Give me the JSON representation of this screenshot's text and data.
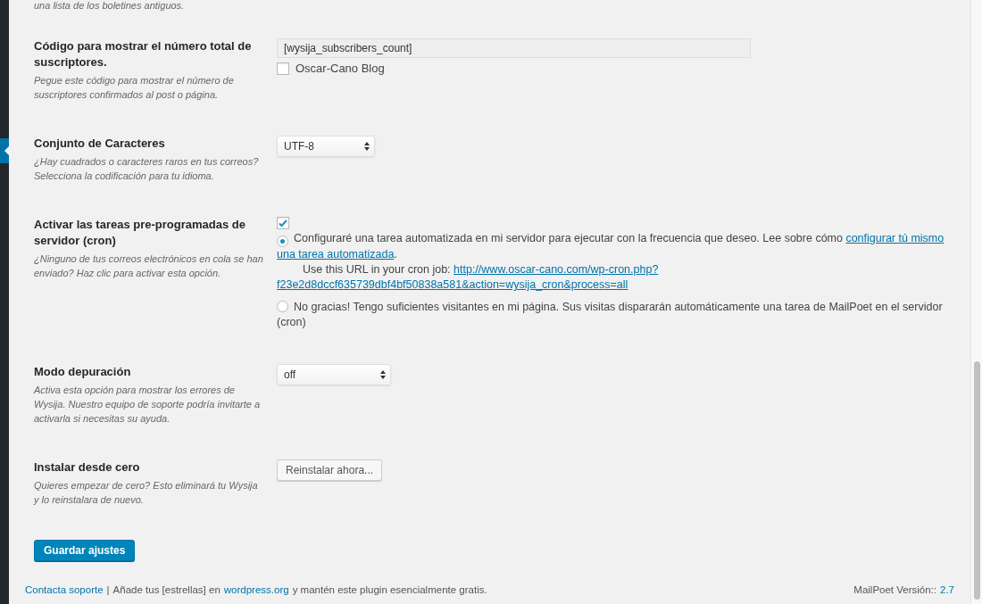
{
  "top_note": "una lista de los boletines antiguos.",
  "settings": [
    {
      "kind": "shortcode",
      "label": "Código para mostrar el número total de suscriptores.",
      "description": "Pegue este código para mostrar el número de suscriptores confirmados al post o página.",
      "value": "[wysija_subscribers_count]",
      "checkbox": {
        "label": "Oscar-Cano Blog",
        "checked": false
      }
    },
    {
      "kind": "select",
      "label": "Conjunto de Caracteres",
      "description": "¿Hay cuadrados o caracteres raros en tus correos? Selecciona la codificación para tu idioma.",
      "value": "UTF-8"
    },
    {
      "kind": "cron",
      "label": "Activar las tareas pre-programadas de servidor (cron)",
      "description": "¿Ninguno de tus correos electrónicos en cola se han enviado? Haz clic para activar esta opción.",
      "checked": true,
      "options": [
        {
          "selected": true,
          "text": "Configuraré una tarea automatizada en mi servidor para ejecutar con la frecuencia que deseo. Lee sobre cómo ",
          "link": [
            "configurar tú mismo",
            "una tarea automatizada"
          ],
          "after": ".",
          "url_label": "Use this URL in your cron job: ",
          "url": [
            "http://www.oscar-cano.com/wp-cron.php?",
            "f23e2d8dccf635739dbf4bf50838a581&action=wysija_cron&process=all"
          ]
        },
        {
          "selected": false,
          "text": "No gracias! Tengo suficientes visitantes en mi página. Sus visitas dispararán automáticamente una tarea de MailPoet en el servidor (cron)"
        }
      ]
    },
    {
      "kind": "select",
      "label": "Modo depuración",
      "description": "Activa esta opción para mostrar los errores de Wysija. Nuestro equipo de soporte podría invitarte a activarla si necesitas su ayuda.",
      "value": "off"
    },
    {
      "kind": "button",
      "label": "Instalar desde cero",
      "description": "Quieres empezar de cero? Esto eliminará tu Wysija y lo reinstalara de nuevo.",
      "button": "Reinstalar ahora..."
    }
  ],
  "save_button": "Guardar ajustes",
  "footer": {
    "support_link": "Contacta soporte",
    "separator": "|",
    "text_before": "Añade tus [estrellas] en",
    "wp_link": "wordpress.org",
    "text_after": "y mantén este plugin esencialmente gratis.",
    "version_label": "MailPoet Versión::",
    "version": "2.7"
  }
}
